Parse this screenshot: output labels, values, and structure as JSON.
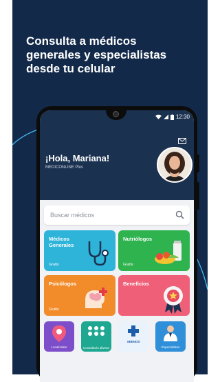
{
  "banner": {
    "headline": [
      "Consulta a médicos",
      "generales y especialistas",
      "desde tu celular"
    ]
  },
  "status_bar": {
    "time": "12:30"
  },
  "header": {
    "greeting": "¡Hola, Mariana!",
    "plan": "MEDICONLINE Plus"
  },
  "search": {
    "placeholder": "Buscar médicos"
  },
  "cards": [
    {
      "title": [
        "Médicos",
        "Generales"
      ],
      "tag": "Gratis",
      "color": "#2eb3d9",
      "icon": "stethoscope-icon"
    },
    {
      "title": [
        "Nutriólogos"
      ],
      "tag": "Gratis",
      "color": "#2fb34f",
      "icon": "fruit-icon"
    },
    {
      "title": [
        "Psicólogos"
      ],
      "tag": "Gratis",
      "color": "#f28c2b",
      "icon": "brain-icon"
    },
    {
      "title": [
        "Beneficios"
      ],
      "tag": "",
      "color": "#ef5f78",
      "icon": "award-ribbon-icon"
    }
  ],
  "minis": [
    {
      "label": "Localizador",
      "color": "#7d4ec9",
      "icon": "map-pin-icon"
    },
    {
      "label": "Consultorio alivean",
      "color": "#1ea891",
      "icon": "people-icon"
    },
    {
      "label": "SEENOS",
      "color": "#eaf2fb",
      "icon": "medical-cross-icon"
    },
    {
      "label": "Especialistas",
      "color": "#2f8fd8",
      "icon": "doctor-icon"
    }
  ]
}
